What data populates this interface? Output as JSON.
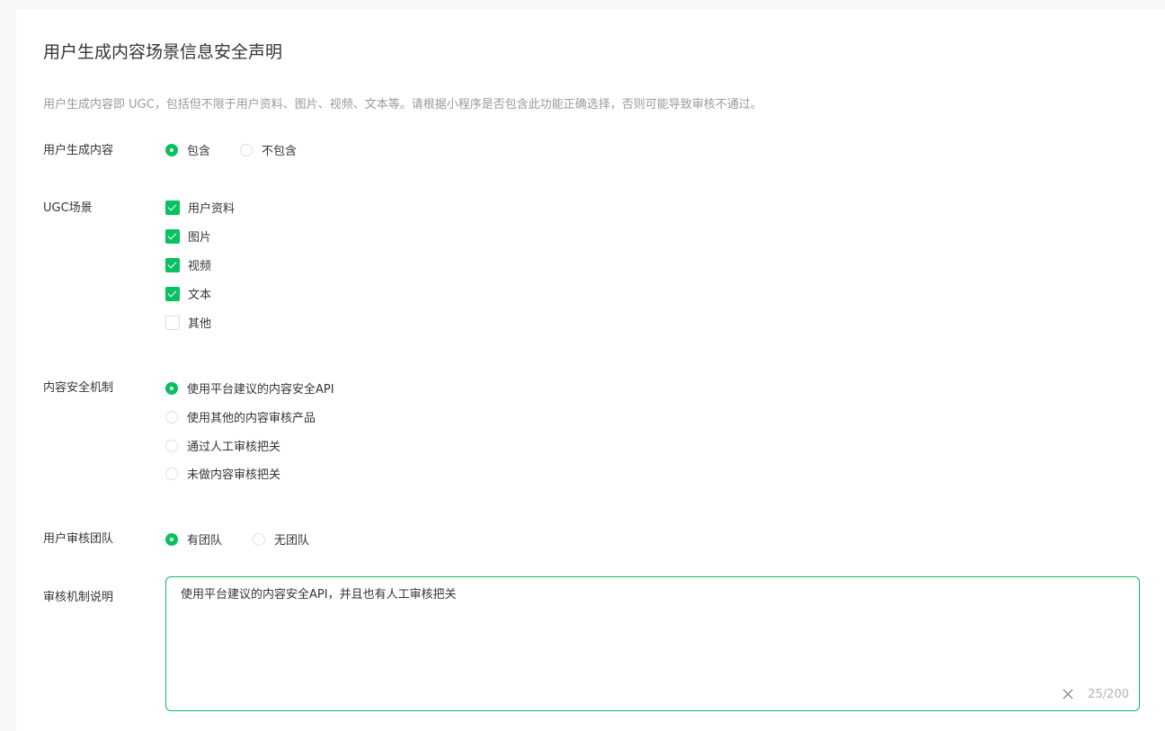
{
  "page": {
    "title": "用户生成内容场景信息安全声明",
    "description": "用户生成内容即 UGC，包括但不限于用户资料、图片、视频、文本等。请根据小程序是否包含此功能正确选择，否则可能导致审核不通过。"
  },
  "ugc_content": {
    "label": "用户生成内容",
    "options": [
      {
        "label": "包含",
        "selected": true
      },
      {
        "label": "不包含",
        "selected": false
      }
    ]
  },
  "ugc_scene": {
    "label": "UGC场景",
    "options": [
      {
        "label": "用户资料",
        "checked": true
      },
      {
        "label": "图片",
        "checked": true
      },
      {
        "label": "视频",
        "checked": true
      },
      {
        "label": "文本",
        "checked": true
      },
      {
        "label": "其他",
        "checked": false
      }
    ]
  },
  "security_mechanism": {
    "label": "内容安全机制",
    "options": [
      {
        "label": "使用平台建议的内容安全API",
        "selected": true
      },
      {
        "label": "使用其他的内容审核产品",
        "selected": false
      },
      {
        "label": "通过人工审核把关",
        "selected": false
      },
      {
        "label": "未做内容审核把关",
        "selected": false
      }
    ]
  },
  "review_team": {
    "label": "用户审核团队",
    "options": [
      {
        "label": "有团队",
        "selected": true
      },
      {
        "label": "无团队",
        "selected": false
      }
    ]
  },
  "review_description": {
    "label": "审核机制说明",
    "value": "使用平台建议的内容安全API，并且也有人工审核把关",
    "counter": "25/200"
  },
  "colors": {
    "accent": "#07c160",
    "muted_text": "#9a9a9a"
  }
}
